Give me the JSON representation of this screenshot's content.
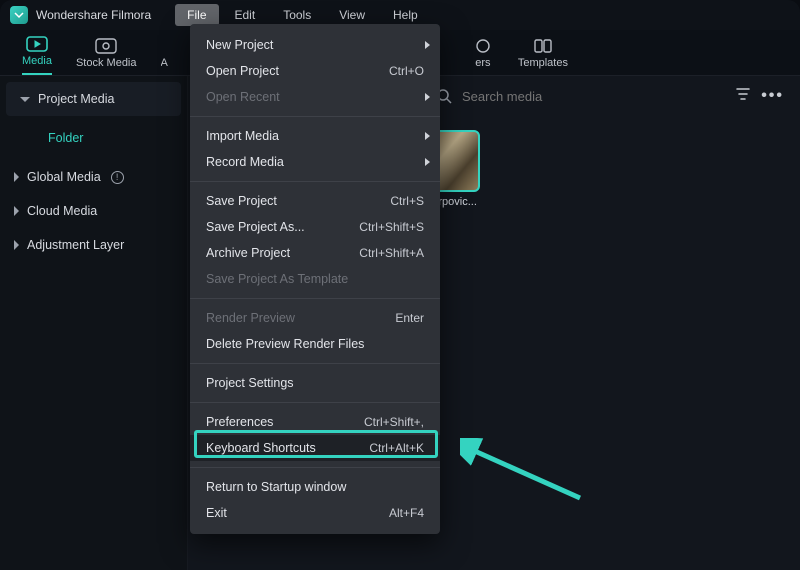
{
  "app": {
    "title": "Wondershare Filmora"
  },
  "menubar": {
    "items": [
      "File",
      "Edit",
      "Tools",
      "View",
      "Help"
    ],
    "active_index": 0
  },
  "tabs": {
    "items": [
      {
        "label": "Media",
        "icon": "media"
      },
      {
        "label": "Stock Media",
        "icon": "stock"
      },
      {
        "label": "A",
        "icon": "audio"
      },
      {
        "label": "ers",
        "icon": "stickers"
      },
      {
        "label": "Templates",
        "icon": "templates"
      }
    ],
    "active_index": 0
  },
  "sidebar": {
    "project_media": "Project Media",
    "folder": "Folder",
    "global_media": "Global Media",
    "cloud_media": "Cloud Media",
    "adjustment_layer": "Adjustment Layer"
  },
  "search": {
    "placeholder": "Search media"
  },
  "clip": {
    "name": "-karpovic..."
  },
  "file_menu": {
    "items": [
      {
        "label": "New Project",
        "submenu": true
      },
      {
        "label": "Open Project",
        "shortcut": "Ctrl+O"
      },
      {
        "label": "Open Recent",
        "submenu": true,
        "disabled": true
      },
      {
        "sep": true
      },
      {
        "label": "Import Media",
        "submenu": true
      },
      {
        "label": "Record Media",
        "submenu": true
      },
      {
        "sep": true
      },
      {
        "label": "Save Project",
        "shortcut": "Ctrl+S"
      },
      {
        "label": "Save Project As...",
        "shortcut": "Ctrl+Shift+S"
      },
      {
        "label": "Archive Project",
        "shortcut": "Ctrl+Shift+A"
      },
      {
        "label": "Save Project As Template",
        "disabled": true
      },
      {
        "sep": true
      },
      {
        "label": "Render Preview",
        "shortcut": "Enter",
        "disabled": true
      },
      {
        "label": "Delete Preview Render Files"
      },
      {
        "sep": true
      },
      {
        "label": "Project Settings"
      },
      {
        "sep": true
      },
      {
        "label": "Preferences",
        "shortcut": "Ctrl+Shift+,"
      },
      {
        "label": "Keyboard Shortcuts",
        "shortcut": "Ctrl+Alt+K",
        "highlight": true
      },
      {
        "sep": true
      },
      {
        "label": "Return to Startup window"
      },
      {
        "label": "Exit",
        "shortcut": "Alt+F4"
      }
    ]
  },
  "annotation": {
    "target": "Keyboard Shortcuts",
    "color": "#34d3c0"
  }
}
